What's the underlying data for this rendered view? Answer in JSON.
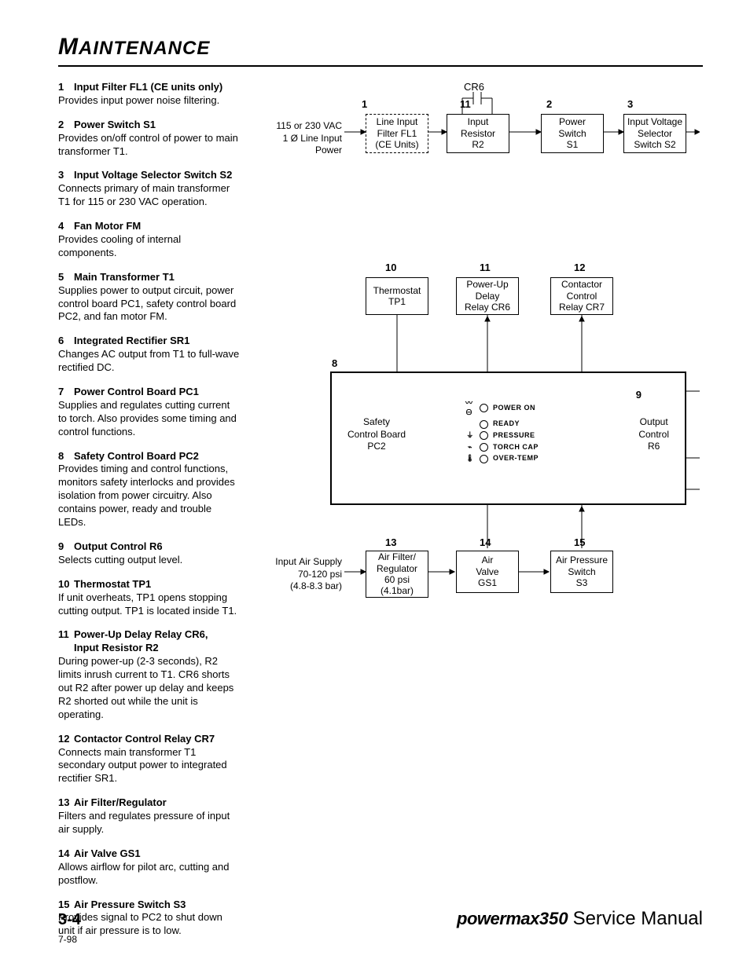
{
  "header": {
    "title_big": "M",
    "title_rest": "AINTENANCE"
  },
  "items": [
    {
      "num": "1",
      "title": "Input Filter FL1 (CE units only)",
      "body": "Provides input power noise filtering."
    },
    {
      "num": "2",
      "title": "Power Switch S1",
      "body": "Provides on/off control of power to main transformer T1."
    },
    {
      "num": "3",
      "title": "Input Voltage Selector Switch S2",
      "body": "Connects primary of main transformer T1 for 115 or 230 VAC operation."
    },
    {
      "num": "4",
      "title": "Fan Motor FM",
      "body": "Provides cooling of internal components."
    },
    {
      "num": "5",
      "title": "Main Transformer T1",
      "body": "Supplies power to output circuit, power control board PC1, safety control board PC2, and fan motor FM."
    },
    {
      "num": "6",
      "title": "Integrated Rectifier SR1",
      "body": "Changes AC output from T1 to full-wave rectified DC."
    },
    {
      "num": "7",
      "title": "Power Control Board PC1",
      "body": "Supplies and regulates cutting current to torch. Also provides some timing and control functions."
    },
    {
      "num": "8",
      "title": "Safety Control Board PC2",
      "body": "Provides timing and control functions, monitors safety interlocks and provides isolation from power circuitry. Also contains power, ready and trouble LEDs."
    },
    {
      "num": "9",
      "title": "Output Control R6",
      "body": "Selects cutting output level."
    },
    {
      "num": "10",
      "title": "Thermostat TP1",
      "body": "If unit overheats, TP1 opens stopping cutting output. TP1 is located inside T1."
    },
    {
      "num": "11",
      "title": "Power-Up Delay Relay CR6, Input Resistor R2",
      "body": "During power-up (2-3 seconds), R2 limits inrush current to T1. CR6 shorts out R2 after power up delay and keeps R2 shorted out while the unit is operating."
    },
    {
      "num": "12",
      "title": "Contactor Control Relay CR7",
      "body": "Connects main transformer T1 secondary output power to integrated rectifier SR1."
    },
    {
      "num": "13",
      "title": "Air Filter/Regulator",
      "body": "Filters and regulates pressure of input air supply."
    },
    {
      "num": "14",
      "title": "Air Valve GS1",
      "body": "Allows airflow for pilot arc, cutting and postflow."
    },
    {
      "num": "15",
      "title": "Air Pressure Switch S3",
      "body": "Provides signal to PC2 to shut down unit if air pressure is to low."
    }
  ],
  "diagram": {
    "cr6": "CR6",
    "row1": {
      "input_label": "115 or 230 VAC\n1 Ø Line Input\nPower",
      "n1": "1",
      "b1": "Line Input\nFilter FL1\n(CE Units)",
      "n11": "11",
      "b2": "Input\nResistor\nR2",
      "n2": "2",
      "b3": "Power\nSwitch\nS1",
      "n3": "3",
      "b4": "Input Voltage\nSelector\nSwitch S2"
    },
    "row2": {
      "n10": "10",
      "b1": "Thermostat\nTP1",
      "n11": "11",
      "b2": "Power-Up\nDelay\nRelay CR6",
      "n12": "12",
      "b3": "Contactor\nControl\nRelay CR7"
    },
    "big": {
      "n8": "8",
      "safety": "Safety\nControl Board\nPC2",
      "leds": [
        "POWER ON",
        "READY",
        "PRESSURE",
        "TORCH CAP",
        "OVER-TEMP"
      ],
      "n9": "9",
      "output": "Output\nControl\nR6"
    },
    "row4": {
      "air_label": "Input Air Supply\n70-120 psi\n(4.8-8.3 bar)",
      "n13": "13",
      "b1": "Air Filter/\nRegulator\n60 psi\n(4.1bar)",
      "n14": "14",
      "b2": "Air\nValve\nGS1",
      "n15": "15",
      "b3": "Air Pressure\nSwitch\nS3"
    }
  },
  "footer": {
    "page": "3-4",
    "brand_pm": "powermax",
    "brand_350": "350",
    "sm": "Service Manual",
    "date": "7-98"
  }
}
